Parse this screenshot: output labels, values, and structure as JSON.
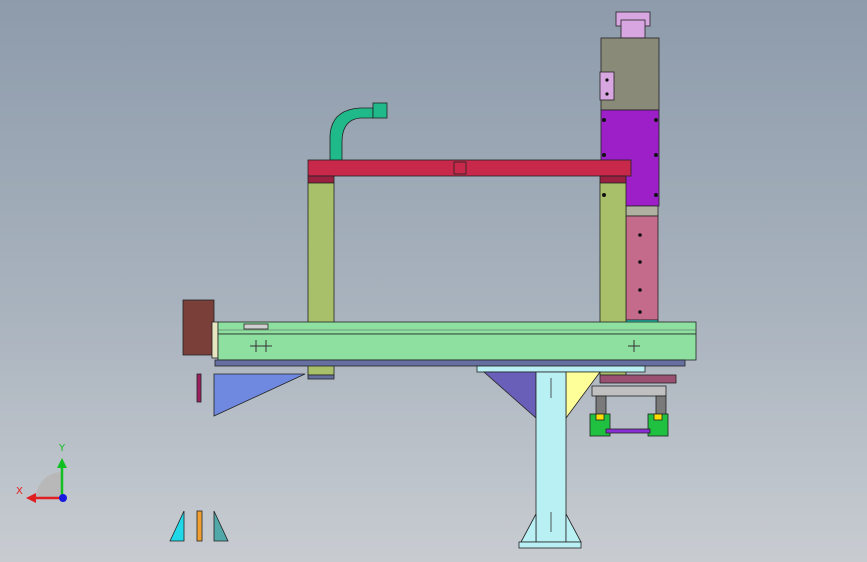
{
  "triad": {
    "x_label": "X",
    "y_label": "Y",
    "x_color": "#e02020",
    "y_color": "#10c020",
    "z_color": "#1818e0"
  },
  "colors": {
    "background_top": "#8d9bab",
    "background_bottom": "#c8ccd1",
    "crossbeam": "#c8284a",
    "columns": "#a9c06a",
    "base_rail": "#8ee0a0",
    "motor_housing": "#7b3f3a",
    "z_axis_upper": "#8a8a78",
    "z_axis_middle": "#9d1fc8",
    "z_axis_lower": "#c46a8a",
    "cable_chain": "#1fb98a",
    "support_leg": "#b8f0f4",
    "gusset_left": "#6f88e0",
    "gusset_right": "#ffff9a",
    "gripper_frame": "#8a2fd6",
    "gripper_green": "#20c040"
  }
}
